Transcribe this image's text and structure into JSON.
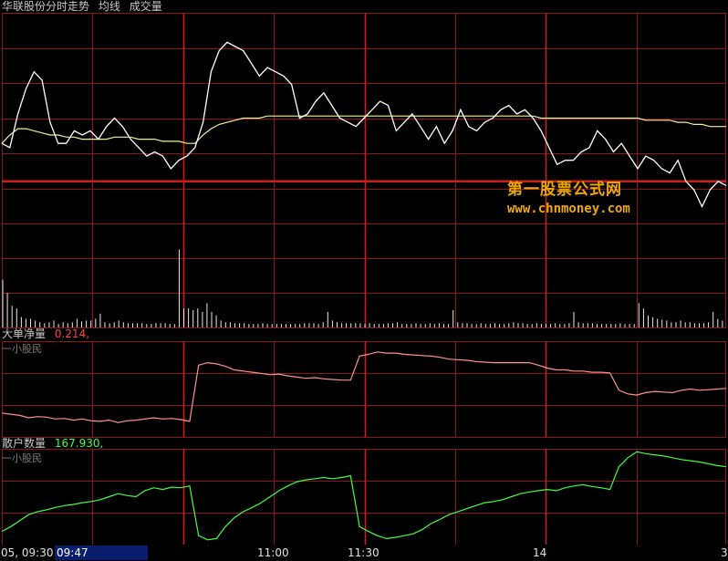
{
  "header": {
    "title": "华联股份分时走势",
    "legend_avg": "均线",
    "legend_vol": "成交量"
  },
  "panels": {
    "big_order": {
      "title": "大单净量",
      "value": "0.214,",
      "value_color": "#ff4040",
      "sub": "一小股民"
    },
    "retail": {
      "title": "散户数量",
      "value": "167.930,",
      "value_color": "#40ff40",
      "sub": "一小股民"
    }
  },
  "watermark": {
    "line1": "第一股票公式网",
    "line2": "www.chnmoney.com"
  },
  "time_axis": {
    "left_label": "05, 09:30",
    "cursor_label": "09:47",
    "ticks": [
      "11:00",
      "11:30",
      "14",
      "3"
    ]
  },
  "colors": {
    "background": "#000000",
    "grid": "#8b1414",
    "accent_line": "#c81e1e",
    "price": "#ffffff",
    "avg": "#f0f0a0",
    "big_order": "#ff9090",
    "retail": "#40ff40",
    "watermark": "#f0a800"
  },
  "chart_data": [
    {
      "type": "line",
      "series": [
        {
          "values": [
            0.9,
            0.8,
            1.6,
            2.2,
            2.6,
            2.4,
            1.4,
            0.9,
            0.9,
            1.2,
            1.1,
            1.2,
            1.0,
            1.3,
            1.5,
            1.3,
            1.0,
            0.8,
            0.6,
            0.7,
            0.6,
            0.3,
            0.5,
            0.6,
            0.8,
            1.4,
            2.6,
            3.1,
            3.3,
            3.2,
            3.1,
            2.8,
            2.5,
            2.7,
            2.6,
            2.5,
            2.3,
            1.5,
            1.6,
            1.9,
            2.1,
            1.8,
            1.5,
            1.4,
            1.3,
            1.5,
            1.7,
            1.9,
            1.8,
            1.2,
            1.4,
            1.6,
            1.3,
            1.0,
            1.3,
            0.9,
            1.2,
            1.7,
            1.3,
            1.2,
            1.4,
            1.5,
            1.7,
            1.8,
            1.6,
            1.7,
            1.5,
            1.2,
            0.8,
            0.4,
            0.5,
            0.5,
            0.7,
            0.8,
            1.2,
            1.0,
            0.7,
            0.9,
            0.6,
            0.3,
            0.6,
            0.5,
            0.3,
            0.2,
            0.5,
            0.0,
            -0.2,
            -0.6,
            -0.2,
            0.0,
            -0.1
          ]
        },
        {
          "values": [
            0.9,
            1.1,
            1.25,
            1.25,
            1.2,
            1.15,
            1.1,
            1.1,
            1.05,
            1.05,
            1.0,
            1.0,
            1.0,
            1.0,
            1.05,
            1.05,
            1.05,
            1.0,
            1.0,
            1.0,
            0.95,
            0.95,
            0.95,
            0.9,
            0.9,
            1.1,
            1.25,
            1.35,
            1.4,
            1.45,
            1.5,
            1.5,
            1.5,
            1.55,
            1.55,
            1.55,
            1.55,
            1.55,
            1.55,
            1.55,
            1.55,
            1.55,
            1.55,
            1.55,
            1.55,
            1.55,
            1.55,
            1.55,
            1.55,
            1.55,
            1.55,
            1.55,
            1.55,
            1.55,
            1.55,
            1.55,
            1.55,
            1.55,
            1.55,
            1.55,
            1.55,
            1.55,
            1.55,
            1.55,
            1.55,
            1.55,
            1.55,
            1.5,
            1.5,
            1.5,
            1.5,
            1.5,
            1.5,
            1.5,
            1.5,
            1.5,
            1.5,
            1.5,
            1.5,
            1.5,
            1.45,
            1.45,
            1.45,
            1.45,
            1.4,
            1.4,
            1.35,
            1.35,
            1.3,
            1.3,
            1.3
          ]
        }
      ],
      "ylim": [
        -1.0,
        4.0
      ]
    },
    {
      "type": "bar",
      "values": [
        55,
        40,
        25,
        22,
        12,
        10,
        10,
        8,
        6,
        5,
        6,
        8,
        4,
        6,
        5,
        6,
        10,
        7,
        8,
        8,
        10,
        16,
        6,
        5,
        6,
        8,
        6,
        5,
        5,
        5,
        5,
        4,
        4,
        5,
        5,
        5,
        4,
        4,
        90,
        22,
        22,
        20,
        22,
        18,
        28,
        18,
        14,
        8,
        6,
        6,
        5,
        5,
        5,
        4,
        4,
        4,
        5,
        4,
        4,
        4,
        4,
        4,
        4,
        4,
        4,
        5,
        5,
        5,
        4,
        6,
        18,
        8,
        6,
        5,
        5,
        5,
        5,
        5,
        4,
        5,
        4,
        4,
        4,
        5,
        5,
        6,
        4,
        4,
        4,
        5,
        4,
        4,
        5,
        4,
        5,
        4,
        4,
        20,
        6,
        5,
        5,
        4,
        4,
        5,
        4,
        4,
        5,
        4,
        4,
        5,
        6,
        5,
        5,
        4,
        4,
        5,
        4,
        4,
        4,
        5,
        4,
        4,
        5,
        18,
        6,
        5,
        5,
        5,
        4,
        4,
        4,
        4,
        4,
        5,
        4,
        4,
        4,
        28,
        22,
        14,
        12,
        10,
        9,
        8,
        6,
        6,
        8,
        6,
        6,
        5,
        5,
        5,
        6,
        18,
        10,
        8
      ],
      "ylim": [
        0,
        120
      ]
    },
    {
      "type": "line",
      "series": [
        {
          "values": [
            -0.6,
            -0.62,
            -0.64,
            -0.68,
            -0.66,
            -0.67,
            -0.7,
            -0.69,
            -0.72,
            -0.7,
            -0.73,
            -0.74,
            -0.72,
            -0.76,
            -0.73,
            -0.72,
            -0.7,
            -0.68,
            -0.7,
            -0.69,
            -0.71,
            -0.74,
            0.2,
            0.24,
            0.22,
            0.18,
            0.12,
            0.1,
            0.08,
            0.06,
            0.04,
            0.05,
            0.02,
            0.0,
            -0.02,
            -0.01,
            -0.03,
            -0.04,
            -0.05,
            -0.05,
            0.35,
            0.38,
            0.42,
            0.4,
            0.4,
            0.38,
            0.37,
            0.36,
            0.35,
            0.33,
            0.3,
            0.29,
            0.28,
            0.26,
            0.25,
            0.24,
            0.24,
            0.24,
            0.24,
            0.24,
            0.2,
            0.15,
            0.12,
            0.12,
            0.1,
            0.1,
            0.08,
            0.08,
            0.07,
            -0.22,
            -0.28,
            -0.3,
            -0.26,
            -0.24,
            -0.25,
            -0.26,
            -0.22,
            -0.2,
            -0.22,
            -0.21,
            -0.2,
            -0.19
          ]
        }
      ],
      "ylim": [
        -1.0,
        0.6
      ]
    },
    {
      "type": "line",
      "series": [
        {
          "values": [
            -0.78,
            -0.7,
            -0.6,
            -0.5,
            -0.45,
            -0.42,
            -0.38,
            -0.35,
            -0.33,
            -0.3,
            -0.28,
            -0.25,
            -0.2,
            -0.15,
            -0.18,
            -0.2,
            -0.1,
            -0.05,
            -0.08,
            -0.04,
            -0.05,
            -0.02,
            -0.85,
            -0.92,
            -0.9,
            -0.7,
            -0.55,
            -0.45,
            -0.38,
            -0.3,
            -0.2,
            -0.1,
            -0.02,
            0.05,
            0.08,
            0.1,
            0.12,
            0.1,
            0.12,
            0.15,
            -0.7,
            -0.78,
            -0.85,
            -0.9,
            -0.88,
            -0.85,
            -0.82,
            -0.75,
            -0.65,
            -0.58,
            -0.5,
            -0.45,
            -0.4,
            -0.35,
            -0.3,
            -0.28,
            -0.25,
            -0.2,
            -0.15,
            -0.12,
            -0.1,
            -0.08,
            -0.1,
            -0.05,
            -0.02,
            0.0,
            -0.03,
            -0.05,
            -0.08,
            0.3,
            0.45,
            0.55,
            0.52,
            0.5,
            0.48,
            0.45,
            0.42,
            0.4,
            0.38,
            0.35,
            0.32,
            0.3
          ]
        }
      ],
      "ylim": [
        -1.0,
        0.6
      ]
    }
  ]
}
